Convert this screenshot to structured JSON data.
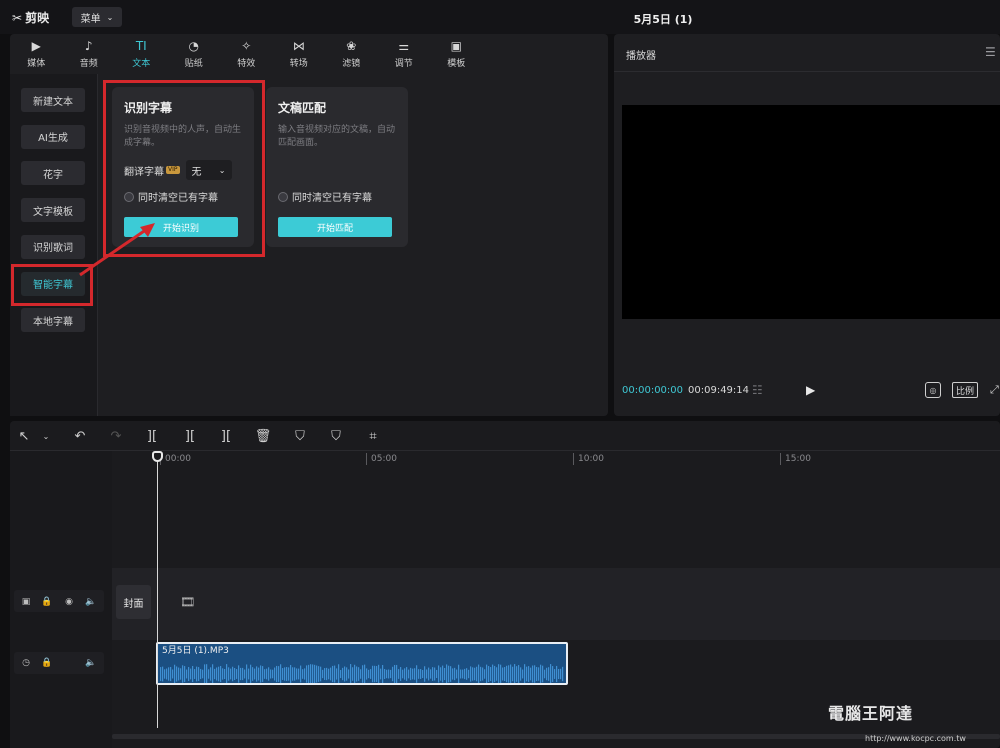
{
  "app": {
    "name": "剪映",
    "menu_label": "菜单",
    "doc_title": "5月5日 (1)"
  },
  "tabs": [
    {
      "label": "媒体",
      "icon": "media-icon",
      "glyph": "▶"
    },
    {
      "label": "音频",
      "icon": "audio-icon",
      "glyph": "♪"
    },
    {
      "label": "文本",
      "icon": "text-icon",
      "glyph": "TI",
      "active": true
    },
    {
      "label": "贴纸",
      "icon": "sticker-icon",
      "glyph": "◔"
    },
    {
      "label": "特效",
      "icon": "effects-icon",
      "glyph": "✧"
    },
    {
      "label": "转场",
      "icon": "transition-icon",
      "glyph": "⋈"
    },
    {
      "label": "滤镜",
      "icon": "filter-icon",
      "glyph": "❀"
    },
    {
      "label": "调节",
      "icon": "adjust-icon",
      "glyph": "⚌"
    },
    {
      "label": "模板",
      "icon": "template-icon",
      "glyph": "▣"
    }
  ],
  "sidebar": {
    "items": [
      "新建文本",
      "AI生成",
      "花字",
      "文字模板",
      "识别歌词",
      "智能字幕",
      "本地字幕"
    ],
    "active_index": 5
  },
  "cards": {
    "recognize": {
      "title": "识别字幕",
      "desc": "识别音视频中的人声，自动生成字幕。",
      "translate_label": "翻译字幕",
      "vip": "VIP",
      "translate_value": "无",
      "clear_label": "同时清空已有字幕",
      "button": "开始识别"
    },
    "match": {
      "title": "文稿匹配",
      "desc": "输入音视频对应的文稿，自动匹配画面。",
      "clear_label": "同时清空已有字幕",
      "button": "开始匹配"
    }
  },
  "player": {
    "title": "播放器",
    "current_time": "00:00:00:00",
    "total_time": "00:09:49:14",
    "ratio_label": "比例"
  },
  "timeline": {
    "ticks": [
      "00:00",
      "05:00",
      "10:00",
      "15:00"
    ],
    "cover_label": "封面",
    "audio_clip_name": "5月5日 (1).MP3"
  },
  "watermark": {
    "text": "電腦王阿達",
    "url": "http://www.kocpc.com.tw"
  },
  "colors": {
    "accent": "#3fc7d3",
    "highlight": "#d4282c",
    "clip": "#1b4f82"
  }
}
